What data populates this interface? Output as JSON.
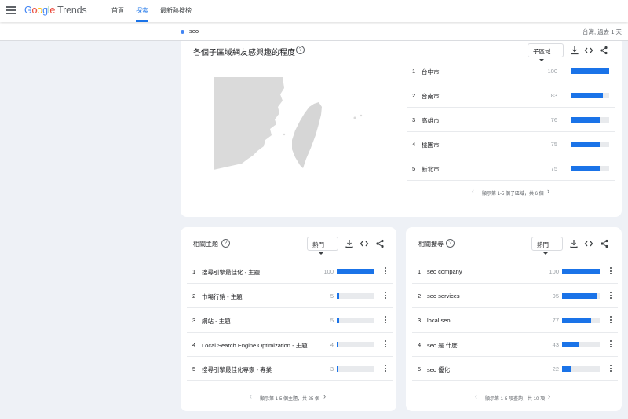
{
  "header": {
    "logo_parts": [
      "G",
      "o",
      "o",
      "g",
      "l",
      "e"
    ],
    "logo_trends": "Trends",
    "tabs": [
      {
        "label": "首頁"
      },
      {
        "label": "探索"
      },
      {
        "label": "最新熱搜榜"
      }
    ],
    "active_tab": "探索"
  },
  "search": {
    "term": "seo",
    "term_color": "#4285f4",
    "scope": "台灣, 過去 1 天"
  },
  "region_card": {
    "title": "各個子區域網友感興趣的程度",
    "dropdown": "子區域",
    "rows": [
      {
        "rank": "1",
        "name": "台中市",
        "value": "100"
      },
      {
        "rank": "2",
        "name": "台南市",
        "value": "83"
      },
      {
        "rank": "3",
        "name": "高雄市",
        "value": "76"
      },
      {
        "rank": "4",
        "name": "桃園市",
        "value": "75"
      },
      {
        "rank": "5",
        "name": "新北市",
        "value": "75"
      }
    ],
    "pager": "顯示第 1-5 個子區域，共 6 個"
  },
  "topics_card": {
    "title": "相關主題",
    "dropdown": "熱門",
    "rows": [
      {
        "rank": "1",
        "name": "搜尋引擎最佳化 - 主題",
        "value": "100"
      },
      {
        "rank": "2",
        "name": "市場行銷 - 主題",
        "value": "5"
      },
      {
        "rank": "3",
        "name": "網站 - 主題",
        "value": "5"
      },
      {
        "rank": "4",
        "name": "Local Search Engine Optimization - 主題",
        "value": "4"
      },
      {
        "rank": "5",
        "name": "搜尋引擎最佳化專家 - 專業",
        "value": "3"
      }
    ],
    "pager": "顯示第 1-5 個主題，共 25 個"
  },
  "queries_card": {
    "title": "相關搜尋",
    "dropdown": "熱門",
    "rows": [
      {
        "rank": "1",
        "name": "seo company",
        "value": "100"
      },
      {
        "rank": "2",
        "name": "seo services",
        "value": "95"
      },
      {
        "rank": "3",
        "name": "local seo",
        "value": "77"
      },
      {
        "rank": "4",
        "name": "seo 是 什麼",
        "value": "43"
      },
      {
        "rank": "5",
        "name": "seo 優化",
        "value": "22"
      }
    ],
    "pager": "顯示第 1-5 項查詢，共 10 項"
  },
  "colors": {
    "accent": "#1a73e8",
    "bar_track": "#e8eaed",
    "map_land": "#dadada"
  }
}
